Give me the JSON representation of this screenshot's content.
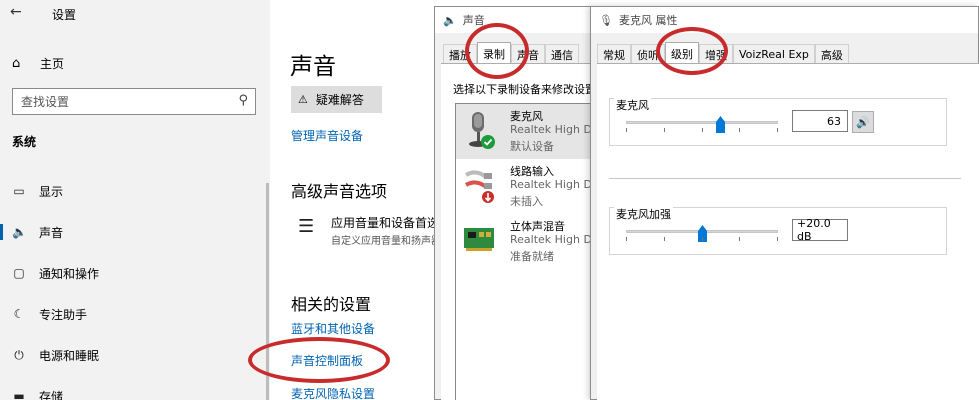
{
  "settings": {
    "back_icon": "back-arrow-icon",
    "title": "设置",
    "home_label": "主页",
    "search_placeholder": "查找设置",
    "section": "系统",
    "nav": [
      {
        "label": "显示",
        "icon": "display-icon"
      },
      {
        "label": "声音",
        "icon": "speaker-icon",
        "active": true
      },
      {
        "label": "通知和操作",
        "icon": "notification-icon"
      },
      {
        "label": "专注助手",
        "icon": "moon-icon"
      },
      {
        "label": "电源和睡眠",
        "icon": "power-icon"
      },
      {
        "label": "存储",
        "icon": "storage-icon"
      }
    ],
    "main": {
      "heading": "声音",
      "troubleshoot": "疑难解答",
      "manage_devices": "管理声音设备",
      "advanced_heading": "高级声音选项",
      "app_volume_title": "应用音量和设备首选项",
      "app_volume_desc": "自定义应用音量和扬声器",
      "related_heading": "相关的设置",
      "bt_link": "蓝牙和其他设备",
      "control_panel_link": "声音控制面板",
      "mic_privacy_link": "麦克风隐私设置"
    }
  },
  "sound_dialog": {
    "title": "声音",
    "tabs": [
      "播放",
      "录制",
      "声音",
      "通信"
    ],
    "active_tab": 1,
    "prompt": "选择以下录制设备来修改设置:",
    "devices": [
      {
        "name": "麦克风",
        "driver": "Realtek High Definition Audio",
        "status": "默认设备",
        "selected": true
      },
      {
        "name": "线路输入",
        "driver": "Realtek High Definition Audio",
        "status": "未插入"
      },
      {
        "name": "立体声混音",
        "driver": "Realtek High Definition Audio",
        "status": "准备就绪"
      }
    ]
  },
  "props_dialog": {
    "title": "麦克风 属性",
    "tabs": [
      "常规",
      "侦听",
      "级别",
      "增强",
      "VoizReal Exp",
      "高级"
    ],
    "active_tab": 2,
    "mic": {
      "label": "麦克风",
      "level": 63,
      "value": "63",
      "max": 100
    },
    "boost": {
      "label": "麦克风加强",
      "level": 0.5,
      "value": "+20.0 dB"
    }
  },
  "colors": {
    "accent": "#0063b1",
    "annotation": "#c82b2b"
  }
}
